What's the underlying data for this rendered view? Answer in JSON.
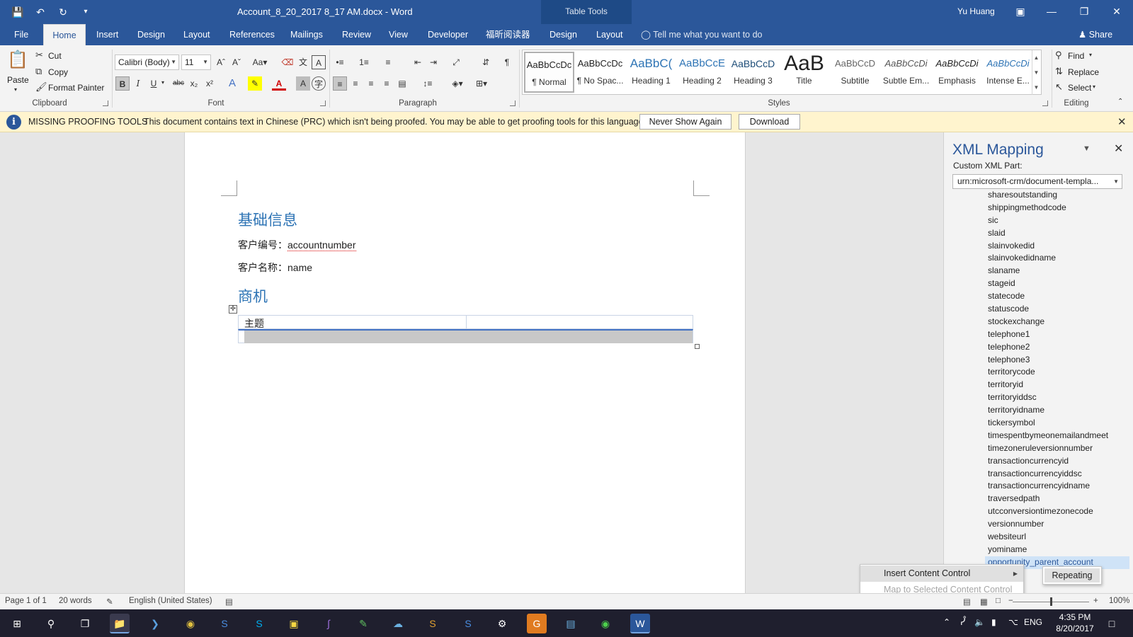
{
  "window": {
    "title": "Account_8_20_2017 8_17 AM.docx  -  Word",
    "context_tab_group": "Table Tools",
    "user": "Yu Huang"
  },
  "ribbon_tabs": [
    "File",
    "Home",
    "Insert",
    "Design",
    "Layout",
    "References",
    "Mailings",
    "Review",
    "View",
    "Developer",
    "福昕阅读器",
    "Design",
    "Layout"
  ],
  "active_tab": "Home",
  "tell_me": "Tell me what you want to do",
  "share": "Share",
  "clipboard": {
    "paste": "Paste",
    "cut": "Cut",
    "copy": "Copy",
    "format_painter": "Format Painter",
    "label": "Clipboard"
  },
  "font": {
    "name": "Calibri (Body)",
    "size": "11",
    "label": "Font",
    "bold": "B",
    "italic": "I",
    "underline": "U",
    "strike": "abc",
    "subscript": "x₂",
    "superscript": "x²",
    "case": "Aa"
  },
  "paragraph": {
    "label": "Paragraph"
  },
  "styles": {
    "label": "Styles",
    "items": [
      {
        "sample": "AaBbCcDc",
        "name": "¶ Normal"
      },
      {
        "sample": "AaBbCcDc",
        "name": "¶ No Spac..."
      },
      {
        "sample": "AaBbC(",
        "name": "Heading 1"
      },
      {
        "sample": "AaBbCcE",
        "name": "Heading 2"
      },
      {
        "sample": "AaBbCcD",
        "name": "Heading 3"
      },
      {
        "sample": "AaB",
        "name": "Title"
      },
      {
        "sample": "AaBbCcD",
        "name": "Subtitle"
      },
      {
        "sample": "AaBbCcDi",
        "name": "Subtle Em..."
      },
      {
        "sample": "AaBbCcDi",
        "name": "Emphasis"
      },
      {
        "sample": "AaBbCcDi",
        "name": "Intense E..."
      }
    ]
  },
  "editing": {
    "label": "Editing",
    "find": "Find",
    "replace": "Replace",
    "select": "Select"
  },
  "message_bar": {
    "title": "MISSING PROOFING TOOLS",
    "text": "This document contains text in Chinese (PRC) which isn't being proofed. You may be able to get proofing tools for this language.",
    "never_show": "Never Show Again",
    "download": "Download"
  },
  "document": {
    "heading1": "基础信息",
    "line1_label": "客户编号：",
    "line1_field": "accountnumber",
    "line2_label": "客户名称：",
    "line2_field": "name",
    "heading2": "商机",
    "table_header": "主题"
  },
  "xml_pane": {
    "title": "XML Mapping",
    "custom_part_label": "Custom XML Part:",
    "custom_part_value": "urn:microsoft-crm/document-templa...",
    "nodes": [
      "sharesoutstanding",
      "shippingmethodcode",
      "sic",
      "slaid",
      "slainvokedid",
      "slainvokedidname",
      "slaname",
      "stageid",
      "statecode",
      "statuscode",
      "stockexchange",
      "telephone1",
      "telephone2",
      "telephone3",
      "territorycode",
      "territoryid",
      "territoryiddsc",
      "territoryidname",
      "tickersymbol",
      "timespentbymeonemailandmeet",
      "timezoneruleversionnumber",
      "transactioncurrencyid",
      "transactioncurrencyiddsc",
      "transactioncurrencyidname",
      "traversedpath",
      "utcconversiontimezonecode",
      "versionnumber",
      "websiteurl",
      "yominame",
      "opportunity_parent_account"
    ]
  },
  "context_menu": {
    "insert": "Insert Content Control",
    "map": "Map to Selected Content Control",
    "sub_repeating": "Repeating"
  },
  "status_bar": {
    "page": "Page 1 of 1",
    "words": "20 words",
    "language": "English (United States)",
    "zoom": "100%",
    "zoom_fraction": 0.5
  },
  "taskbar": {
    "language": "ENG",
    "time": "4:35 PM",
    "date": "8/20/2017"
  },
  "colors": {
    "brand": "#2b579a",
    "message_bar": "#fff4ce",
    "heading": "#2e74b5"
  }
}
